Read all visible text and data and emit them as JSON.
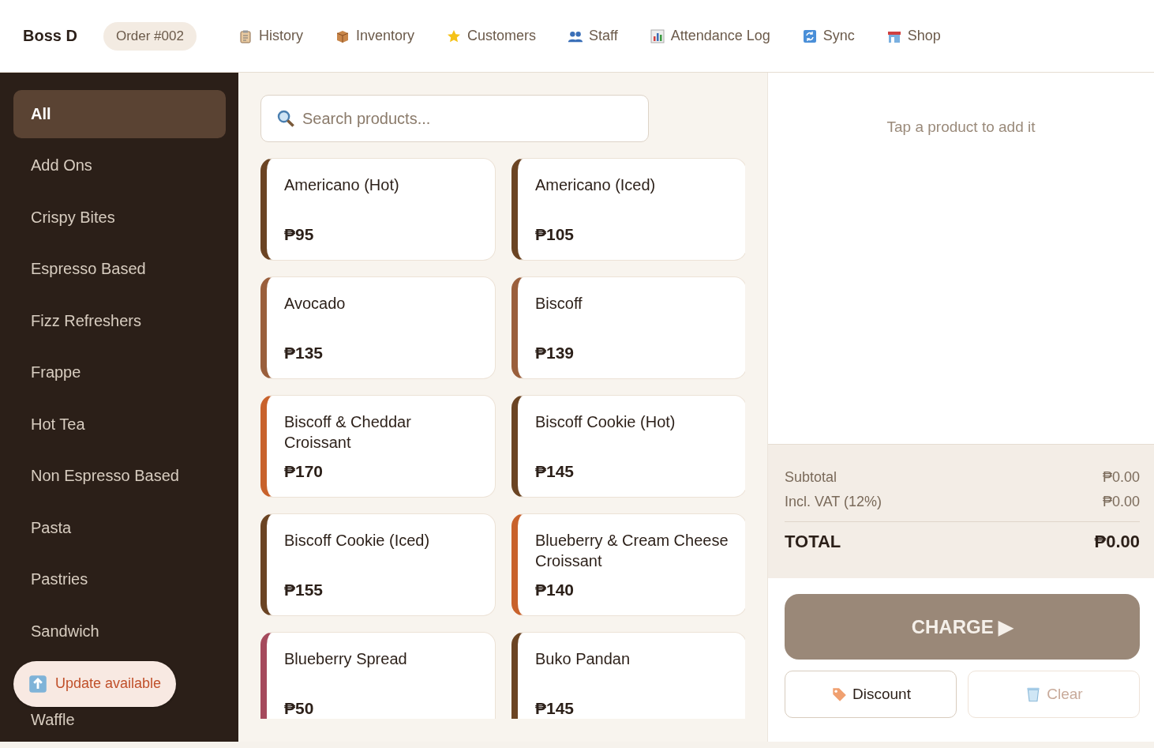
{
  "brand": "Boss D",
  "order_badge": "Order #002",
  "nav": [
    {
      "label": "History",
      "kind": "clipboard"
    },
    {
      "label": "Inventory",
      "kind": "box"
    },
    {
      "label": "Customers",
      "kind": "star"
    },
    {
      "label": "Staff",
      "kind": "people"
    },
    {
      "label": "Attendance Log",
      "kind": "chart"
    },
    {
      "label": "Sync",
      "kind": "sync"
    },
    {
      "label": "Shop",
      "kind": "store"
    }
  ],
  "categories": [
    {
      "label": "All",
      "selected": true
    },
    {
      "label": "Add Ons",
      "selected": false
    },
    {
      "label": "Crispy Bites",
      "selected": false
    },
    {
      "label": "Espresso Based",
      "selected": false
    },
    {
      "label": "Fizz Refreshers",
      "selected": false
    },
    {
      "label": "Frappe",
      "selected": false
    },
    {
      "label": "Hot Tea",
      "selected": false
    },
    {
      "label": "Non Espresso Based",
      "selected": false
    },
    {
      "label": "Pasta",
      "selected": false
    },
    {
      "label": "Pastries",
      "selected": false
    },
    {
      "label": "Sandwich",
      "selected": false
    },
    {
      "label": "Waffle",
      "selected": false
    }
  ],
  "update_notice": "Update available",
  "search": {
    "placeholder": "Search products..."
  },
  "products": [
    {
      "name": "Americano (Hot)",
      "price": "₱95",
      "color": "#6b4423"
    },
    {
      "name": "Americano (Iced)",
      "price": "₱105",
      "color": "#6b4423"
    },
    {
      "name": "Avocado",
      "price": "₱135",
      "color": "#9a5f3c"
    },
    {
      "name": "Biscoff",
      "price": "₱139",
      "color": "#9a5f3c"
    },
    {
      "name": "Biscoff & Cheddar Croissant",
      "price": "₱170",
      "color": "#c8622c"
    },
    {
      "name": "Biscoff Cookie (Hot)",
      "price": "₱145",
      "color": "#6b4423"
    },
    {
      "name": "Biscoff Cookie (Iced)",
      "price": "₱155",
      "color": "#6b4423"
    },
    {
      "name": "Blueberry & Cream Cheese Croissant",
      "price": "₱140",
      "color": "#c8622c"
    },
    {
      "name": "Blueberry Spread",
      "price": "₱50",
      "color": "#a54a5c"
    },
    {
      "name": "Buko Pandan",
      "price": "₱145",
      "color": "#6b4423"
    }
  ],
  "cart": {
    "empty_hint": "Tap a product to add it"
  },
  "totals": {
    "subtotal_label": "Subtotal",
    "subtotal": "₱0.00",
    "vat_label": "Incl. VAT (12%)",
    "vat": "₱0.00",
    "total_label": "TOTAL",
    "total": "₱0.00"
  },
  "charge": {
    "label": "CHARGE ▶",
    "disabled": true
  },
  "discount": {
    "label": "Discount",
    "disabled": false
  },
  "clear": {
    "label": "Clear",
    "disabled": true
  }
}
